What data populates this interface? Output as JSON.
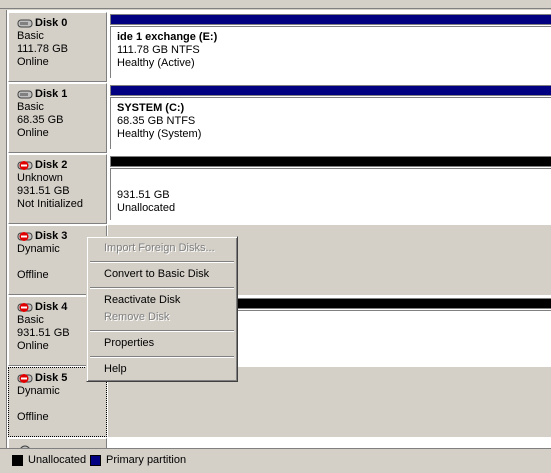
{
  "disks": [
    {
      "title": "Disk 0",
      "type": "Basic",
      "size": "111.78 GB",
      "status": "Online",
      "status_icon": "disk-icon",
      "volume": {
        "name": "ide 1 exchange  (E:)",
        "detail": "111.78 GB NTFS",
        "health": "Healthy (Active)",
        "bar_color": "#000080"
      }
    },
    {
      "title": "Disk 1",
      "type": "Basic",
      "size": "68.35 GB",
      "status": "Online",
      "status_icon": "disk-icon",
      "volume": {
        "name": "SYSTEM  (C:)",
        "detail": "68.35 GB NTFS",
        "health": "Healthy (System)",
        "bar_color": "#000080"
      }
    },
    {
      "title": "Disk 2",
      "type": "Unknown",
      "size": "931.51 GB",
      "status": "Not Initialized",
      "status_icon": "disk-error-icon",
      "volume": {
        "name": "",
        "detail": "931.51 GB",
        "health": "Unallocated",
        "bar_color": "#000000"
      }
    },
    {
      "title": "Disk 3",
      "type": "Dynamic",
      "size": "",
      "status": "Offline",
      "status_icon": "disk-error-icon"
    },
    {
      "title": "Disk 4",
      "type": "Basic",
      "size": "931.51 GB",
      "status": "Online",
      "status_icon": "disk-error-icon",
      "volume": {
        "bar_color": "#000000"
      }
    },
    {
      "title": "Disk 5",
      "type": "Dynamic",
      "size": "",
      "status": "Offline",
      "status_icon": "disk-error-icon"
    }
  ],
  "context_menu": {
    "items": [
      {
        "label": "Import Foreign Disks...",
        "enabled": false
      },
      {
        "label": "Convert to Basic Disk",
        "enabled": true
      },
      {
        "label": "Reactivate Disk",
        "enabled": true
      },
      {
        "label": "Remove Disk",
        "enabled": false
      },
      {
        "label": "Properties",
        "enabled": true
      },
      {
        "label": "Help",
        "enabled": true
      }
    ]
  },
  "legend": {
    "unallocated": {
      "label": "Unallocated",
      "color": "#000000"
    },
    "primary": {
      "label": "Primary partition",
      "color": "#000080"
    }
  }
}
